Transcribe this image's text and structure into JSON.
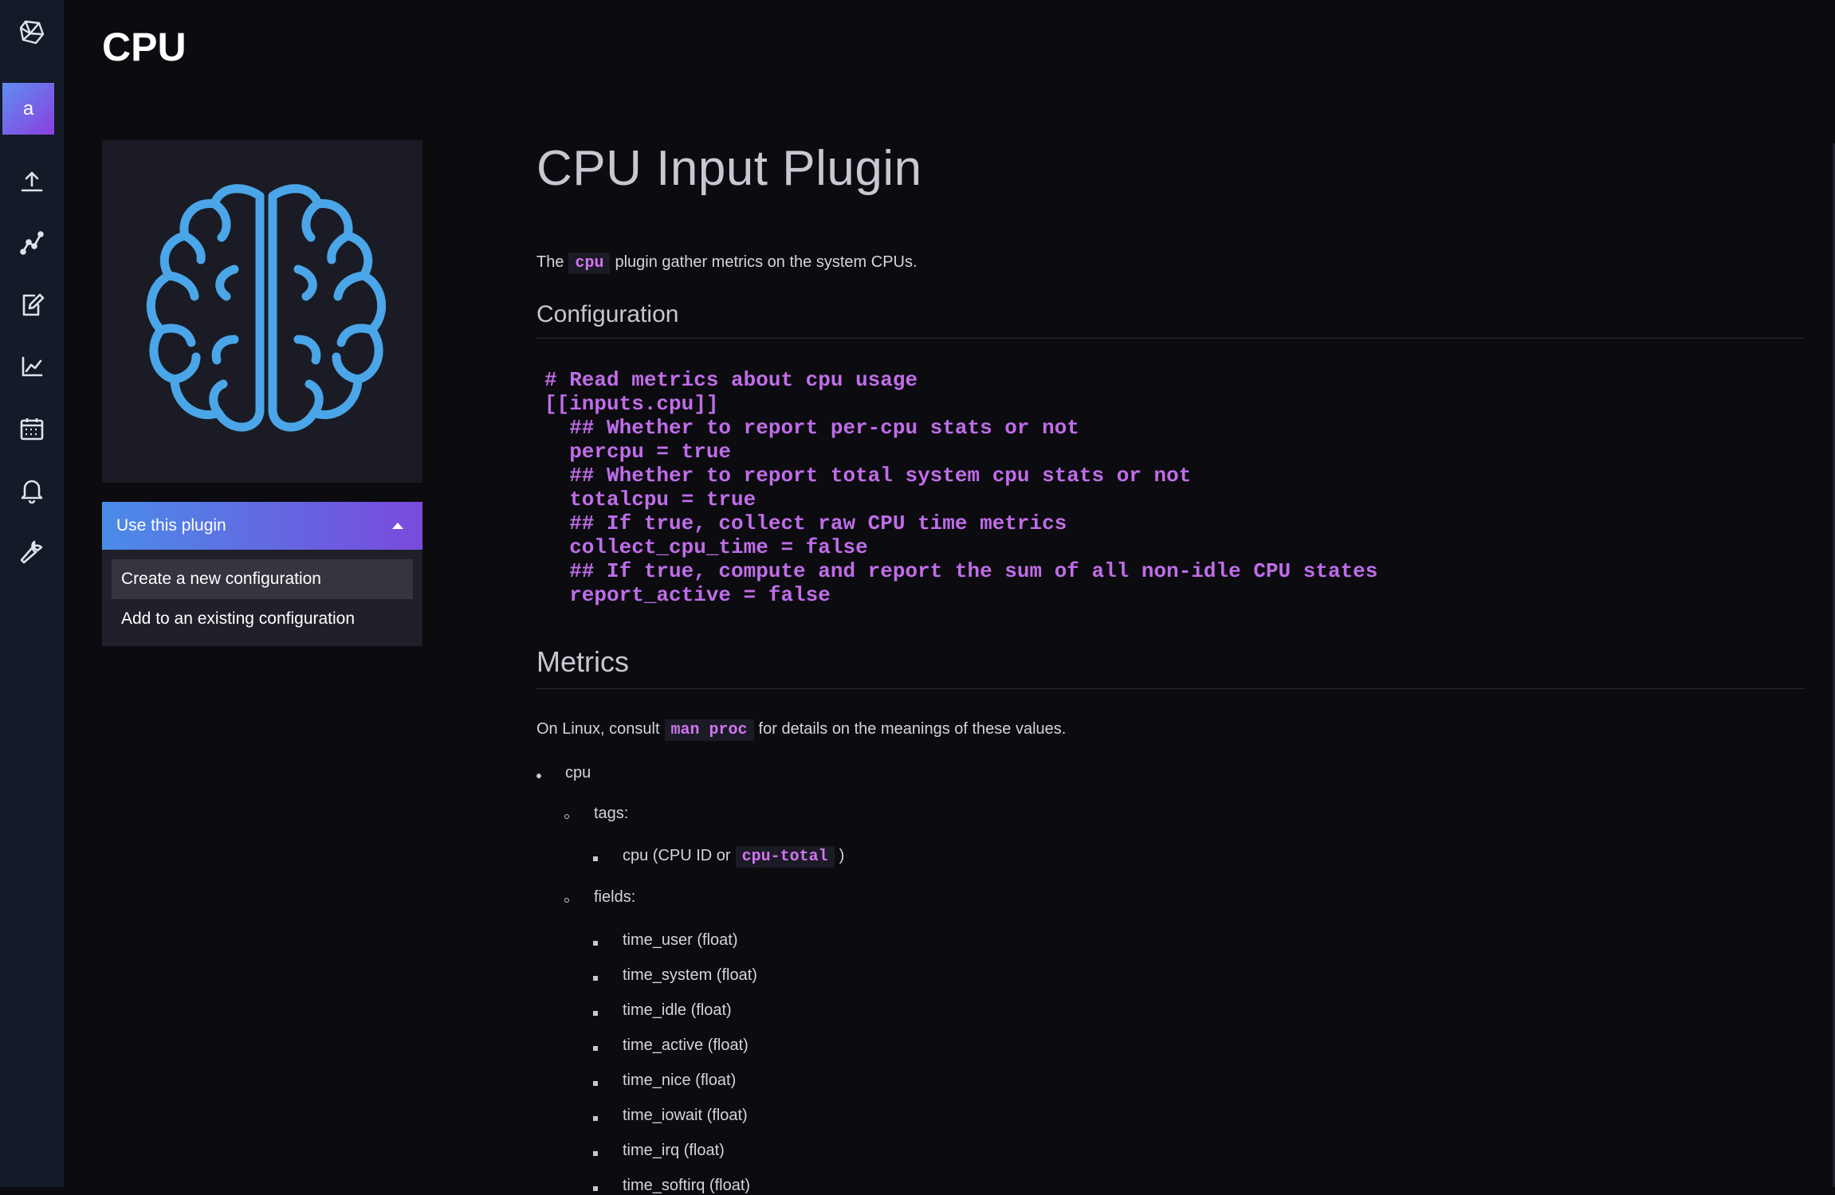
{
  "nav": {
    "org_initial": "a",
    "icons": [
      "logo-icon",
      "upload-icon",
      "graph-icon",
      "notebook-icon",
      "chart-icon",
      "calendar-icon",
      "bell-icon",
      "wrench-icon"
    ]
  },
  "page": {
    "title": "CPU"
  },
  "plugin_card": {
    "logo_icon": "brain-icon",
    "button_label": "Use this plugin",
    "menu": [
      "Create a new configuration",
      "Add to an existing configuration"
    ]
  },
  "readme": {
    "title": "CPU Input Plugin",
    "intro": {
      "before": "The",
      "code": "cpu",
      "after": "plugin gather metrics on the system CPUs."
    },
    "config_heading": "Configuration",
    "config_code": "# Read metrics about cpu usage\n[[inputs.cpu]]\n  ## Whether to report per-cpu stats or not\n  percpu = true\n  ## Whether to report total system cpu stats or not\n  totalcpu = true\n  ## If true, collect raw CPU time metrics\n  collect_cpu_time = false\n  ## If true, compute and report the sum of all non-idle CPU states\n  report_active = false",
    "metrics_heading": "Metrics",
    "metrics_intro": {
      "before": "On Linux, consult",
      "code": "man proc",
      "after": "for details on the meanings of these values."
    },
    "measurement": "cpu",
    "tags_label": "tags:",
    "tag_item": {
      "text": "cpu (CPU ID or",
      "code": "cpu-total",
      "close": ")"
    },
    "fields_label": "fields:",
    "fields": [
      "time_user (float)",
      "time_system (float)",
      "time_idle (float)",
      "time_active (float)",
      "time_nice (float)",
      "time_iowait (float)",
      "time_irq (float)",
      "time_softirq (float)"
    ]
  },
  "colors": {
    "accent_start": "#4a8ce8",
    "accent_end": "#7a4adc",
    "code": "#c06de8",
    "brain": "#4aa6e8"
  }
}
